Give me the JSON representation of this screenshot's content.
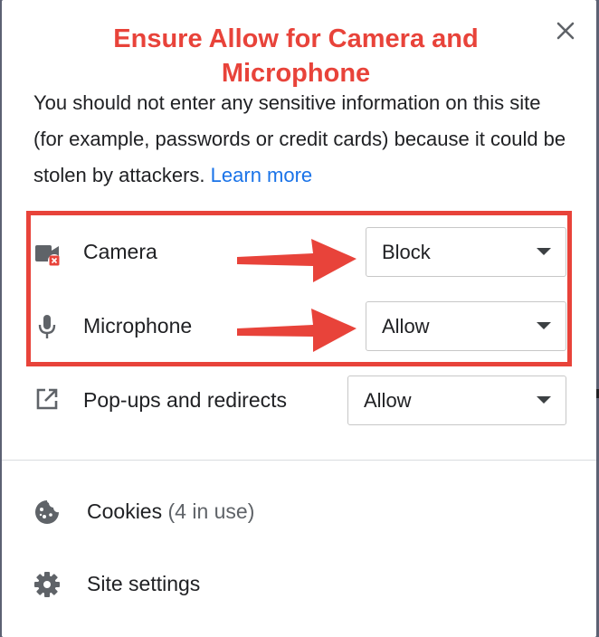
{
  "annotation": {
    "title": "Ensure Allow for Camera and Microphone",
    "accent_color": "#e8433a"
  },
  "dialog": {
    "close_icon": "close-icon",
    "warning_text": "You should not enter any sensitive information on this site (for example, passwords or credit cards) because it could be stolen by attackers. ",
    "learn_more": "Learn more",
    "link_color": "#1a73e8"
  },
  "permissions": {
    "camera": {
      "label": "Camera",
      "value": "Block",
      "icon": "camera-blocked-icon"
    },
    "microphone": {
      "label": "Microphone",
      "value": "Allow",
      "icon": "microphone-icon"
    },
    "popups": {
      "label": "Pop-ups and redirects",
      "value": "Allow",
      "icon": "open-in-new-icon"
    }
  },
  "footer": {
    "cookies_label": "Cookies",
    "cookies_count": "(4 in use)",
    "site_settings_label": "Site settings",
    "cookies_icon": "cookie-icon",
    "settings_icon": "gear-icon"
  }
}
